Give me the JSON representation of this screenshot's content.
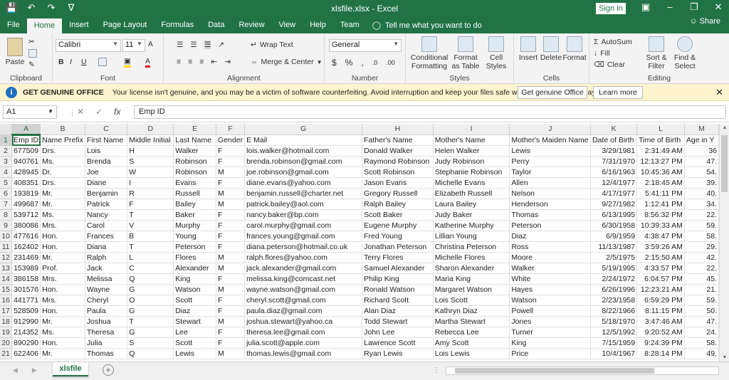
{
  "window": {
    "title": "xlsfile.xlsx  -  Excel",
    "sign_in": "Sign in",
    "share": "Share"
  },
  "tabs": [
    "File",
    "Home",
    "Insert",
    "Page Layout",
    "Formulas",
    "Data",
    "Review",
    "View",
    "Help",
    "Team"
  ],
  "tell_me": "Tell me what you want to do",
  "ribbon": {
    "clipboard": {
      "label": "Clipboard",
      "paste": "Paste"
    },
    "font": {
      "label": "Font",
      "name": "Calibri",
      "size": "11",
      "bold": "B",
      "italic": "I",
      "underline": "U"
    },
    "alignment": {
      "label": "Alignment",
      "wrap": "Wrap Text",
      "merge": "Merge & Center"
    },
    "number": {
      "label": "Number",
      "format": "General",
      "currency": "$",
      "percent": "%",
      "comma": ","
    },
    "styles": {
      "label": "Styles",
      "conditional": "Conditional Formatting",
      "format_table": "Format as Table",
      "cell_styles": "Cell Styles"
    },
    "cells": {
      "label": "Cells",
      "insert": "Insert",
      "delete": "Delete",
      "format": "Format"
    },
    "editing": {
      "label": "Editing",
      "autosum": "AutoSum",
      "fill": "Fill",
      "clear": "Clear",
      "sort": "Sort & Filter",
      "find": "Find & Select"
    }
  },
  "message_bar": {
    "title": "GET GENUINE OFFICE",
    "text": "Your license isn't genuine, and you may be a victim of software counterfeiting. Avoid interruption and keep your files safe with genuine Office today.",
    "button1": "Get genuine Office",
    "button2": "Learn more"
  },
  "formula_bar": {
    "name_box": "A1",
    "fx": "fx",
    "value": "Emp ID"
  },
  "columns": [
    "A",
    "B",
    "C",
    "D",
    "E",
    "F",
    "G",
    "H",
    "I",
    "J",
    "K",
    "L",
    "M"
  ],
  "header_row": [
    "Emp ID",
    "Name Prefix",
    "First Name",
    "Middle Initial",
    "Last Name",
    "Gender",
    "E Mail",
    "Father's Name",
    "Mother's Name",
    "Mother's Maiden Name",
    "Date of Birth",
    "Time of Birth",
    "Age in Y"
  ],
  "rows": [
    [
      "677509",
      "Drs.",
      "Lois",
      "H",
      "Walker",
      "F",
      "lois.walker@hotmail.com",
      "Donald Walker",
      "Helen Walker",
      "Lewis",
      "3/29/1981",
      "2:31:49 AM",
      "36"
    ],
    [
      "940761",
      "Ms.",
      "Brenda",
      "S",
      "Robinson",
      "F",
      "brenda.robinson@gmail.com",
      "Raymond Robinson",
      "Judy Robinson",
      "Perry",
      "7/31/1970",
      "12:13:27 PM",
      "47."
    ],
    [
      "428945",
      "Dr.",
      "Joe",
      "W",
      "Robinson",
      "M",
      "joe.robinson@gmail.com",
      "Scott Robinson",
      "Stephanie Robinson",
      "Taylor",
      "6/16/1963",
      "10:45:36 AM",
      "54."
    ],
    [
      "408351",
      "Drs.",
      "Diane",
      "I",
      "Evans",
      "F",
      "diane.evans@yahoo.com",
      "Jason Evans",
      "Michelle Evans",
      "Allen",
      "12/4/1977",
      "2:18:45 AM",
      "39."
    ],
    [
      "193819",
      "Mr.",
      "Benjamin",
      "R",
      "Russell",
      "M",
      "benjamin.russell@charter.net",
      "Gregory Russell",
      "Elizabeth Russell",
      "Nelson",
      "4/17/1977",
      "5:41:11 PM",
      "40."
    ],
    [
      "499687",
      "Mr.",
      "Patrick",
      "F",
      "Bailey",
      "M",
      "patrick.bailey@aol.com",
      "Ralph Bailey",
      "Laura Bailey",
      "Henderson",
      "9/27/1982",
      "1:12:41 PM",
      "34."
    ],
    [
      "539712",
      "Ms.",
      "Nancy",
      "T",
      "Baker",
      "F",
      "nancy.baker@bp.com",
      "Scott Baker",
      "Judy Baker",
      "Thomas",
      "6/13/1995",
      "8:56:32 PM",
      "22."
    ],
    [
      "380086",
      "Mrs.",
      "Carol",
      "V",
      "Murphy",
      "F",
      "carol.murphy@gmail.com",
      "Eugene Murphy",
      "Katherine Murphy",
      "Peterson",
      "6/30/1958",
      "10:39:33 AM",
      "59."
    ],
    [
      "477616",
      "Hon.",
      "Frances",
      "B",
      "Young",
      "F",
      "frances.young@gmail.com",
      "Fred Young",
      "Lillian Young",
      "Diaz",
      "6/9/1959",
      "4:38:47 PM",
      "58."
    ],
    [
      "162402",
      "Hon.",
      "Diana",
      "T",
      "Peterson",
      "F",
      "diana.peterson@hotmail.co.uk",
      "Jonathan Peterson",
      "Christina Peterson",
      "Ross",
      "11/13/1987",
      "3:59:26 AM",
      "29."
    ],
    [
      "231469",
      "Mr.",
      "Ralph",
      "L",
      "Flores",
      "M",
      "ralph.flores@yahoo.com",
      "Terry Flores",
      "Michelle Flores",
      "Moore",
      "2/5/1975",
      "2:15:50 AM",
      "42."
    ],
    [
      "153989",
      "Prof.",
      "Jack",
      "C",
      "Alexander",
      "M",
      "jack.alexander@gmail.com",
      "Samuel Alexander",
      "Sharon Alexander",
      "Walker",
      "5/19/1995",
      "4:33:57 PM",
      "22."
    ],
    [
      "386158",
      "Mrs.",
      "Melissa",
      "Q",
      "King",
      "F",
      "melissa.king@comcast.net",
      "Philip King",
      "Maria King",
      "White",
      "2/24/1972",
      "6:04:57 PM",
      "45."
    ],
    [
      "301576",
      "Hon.",
      "Wayne",
      "G",
      "Watson",
      "M",
      "wayne.watson@gmail.com",
      "Ronald Watson",
      "Margaret Watson",
      "Hayes",
      "6/26/1996",
      "12:23:21 AM",
      "21."
    ],
    [
      "441771",
      "Mrs.",
      "Cheryl",
      "O",
      "Scott",
      "F",
      "cheryl.scott@gmail.com",
      "Richard Scott",
      "Lois Scott",
      "Watson",
      "2/23/1958",
      "6:59:29 PM",
      "59."
    ],
    [
      "528509",
      "Hon.",
      "Paula",
      "G",
      "Diaz",
      "F",
      "paula.diaz@gmail.com",
      "Alan Diaz",
      "Kathryn Diaz",
      "Powell",
      "8/22/1966",
      "8:11:15 PM",
      "50."
    ],
    [
      "912990",
      "Mr.",
      "Joshua",
      "T",
      "Stewart",
      "M",
      "joshua.stewart@yahoo.ca",
      "Todd Stewart",
      "Martha Stewart",
      "Jones",
      "5/18/1970",
      "3:47:46 AM",
      "47."
    ],
    [
      "214352",
      "Ms.",
      "Theresa",
      "G",
      "Lee",
      "F",
      "theresa.lee@gmail.com",
      "John Lee",
      "Rebecca Lee",
      "Turner",
      "12/5/1992",
      "9:20:52 AM",
      "24."
    ],
    [
      "890290",
      "Hon.",
      "Julia",
      "S",
      "Scott",
      "F",
      "julia.scott@apple.com",
      "Lawrence Scott",
      "Amy Scott",
      "King",
      "7/15/1959",
      "9:24:39 PM",
      "58."
    ],
    [
      "622406",
      "Mr.",
      "Thomas",
      "Q",
      "Lewis",
      "M",
      "thomas.lewis@gmail.com",
      "Ryan Lewis",
      "Lois Lewis",
      "Price",
      "10/4/1967",
      "8:28:14 PM",
      "49."
    ]
  ],
  "sheet_tab": "xlsfile",
  "row_numbers": [
    "1",
    "2",
    "3",
    "4",
    "5",
    "6",
    "7",
    "8",
    "9",
    "10",
    "11",
    "12",
    "13",
    "14",
    "15",
    "16",
    "17",
    "18",
    "19",
    "20",
    "21"
  ]
}
